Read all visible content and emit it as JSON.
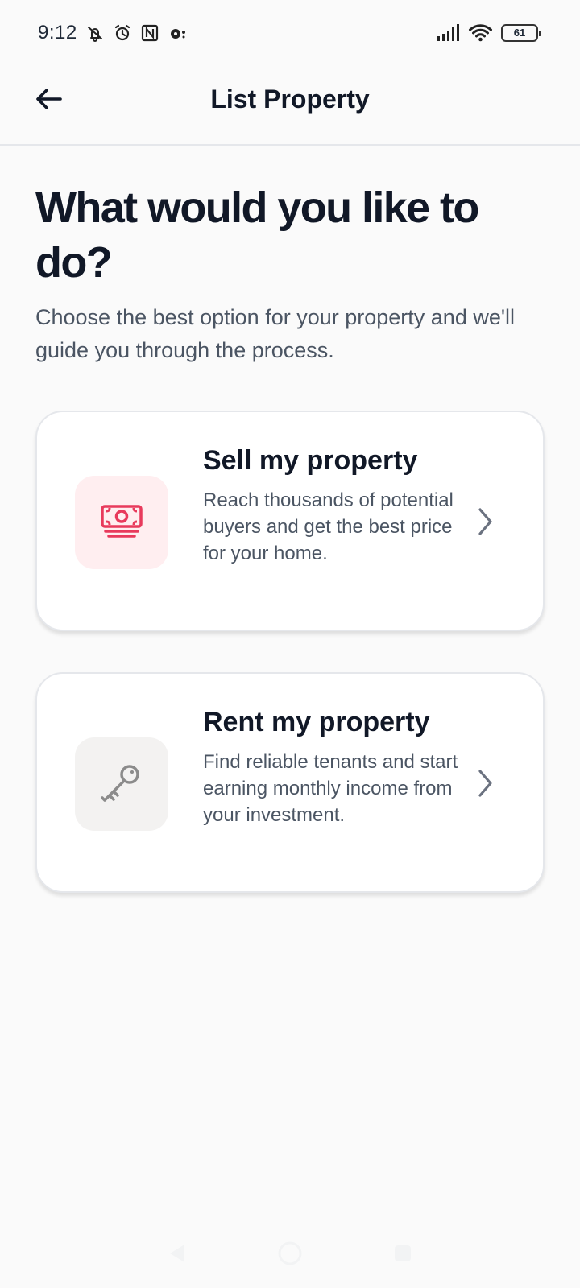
{
  "status_bar": {
    "time": "9:12",
    "battery": "61",
    "icons": [
      "mute-notification-icon",
      "alarm-icon",
      "nfc-icon",
      "location-icon",
      "signal-icon",
      "wifi-icon",
      "battery-icon"
    ]
  },
  "header": {
    "title": "List Property",
    "back_icon": "arrow-left-icon"
  },
  "main": {
    "heading": "What would you like to do?",
    "intro": "Choose the best option for your property and we'll guide you through the process."
  },
  "options": [
    {
      "title": "Sell my property",
      "description": "Reach thousands of potential buyers and get the best price for your home.",
      "icon": "money-icon",
      "icon_color": "#e83a5c",
      "icon_bg": "#ffeef0"
    },
    {
      "title": "Rent my property",
      "description": "Find reliable tenants and start earning monthly income from your investment.",
      "icon": "key-icon",
      "icon_color": "#8b8b8b",
      "icon_bg": "#f3f2f1"
    }
  ],
  "bottom_navigation": {
    "icons": [
      "back-triangle-icon",
      "home-circle-icon",
      "recents-square-icon"
    ]
  }
}
